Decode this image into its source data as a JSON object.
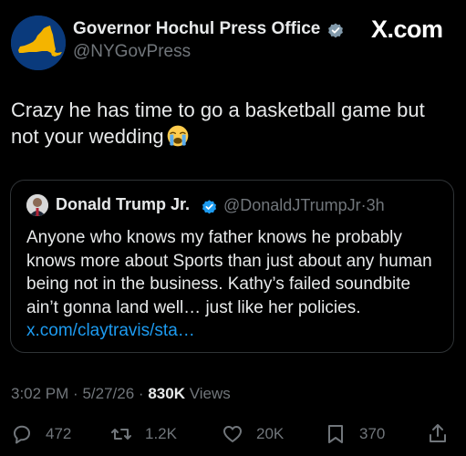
{
  "header": {
    "author_name": "Governor Hochul Press Office",
    "author_handle": "@NYGovPress",
    "site_brand": "X.com",
    "avatar_icon": "new-york-state-map-icon",
    "avatar_color": "#0a3a7c",
    "avatar_state_color": "#f4b400"
  },
  "tweet": {
    "text": "Crazy he has time to go a basketball game but not your wedding",
    "emoji": "loudly-crying-face-emoji"
  },
  "quote": {
    "author_name": "Donald Trump Jr.",
    "handle": "@DonaldJTrumpJr",
    "separator": "·",
    "age": "3h",
    "text": "Anyone who knows my father knows he probably knows more about Sports than just about any human being not in the business. Kathy’s failed soundbite ain’t gonna land well… just like her policies.",
    "link": "x.com/claytravis/sta…"
  },
  "meta": {
    "time": "3:02 PM",
    "separator": "·",
    "date": "5/27/26",
    "views_count": "830K",
    "views_label": "Views"
  },
  "actions": {
    "replies": "472",
    "reposts": "1.2K",
    "likes": "20K",
    "bookmarks": "370"
  },
  "colors": {
    "background": "#000000",
    "text": "#e7e9ea",
    "secondary_text": "#71767b",
    "link": "#1d9bf0",
    "verified": "#1d9bf0",
    "border": "#2f3336"
  }
}
